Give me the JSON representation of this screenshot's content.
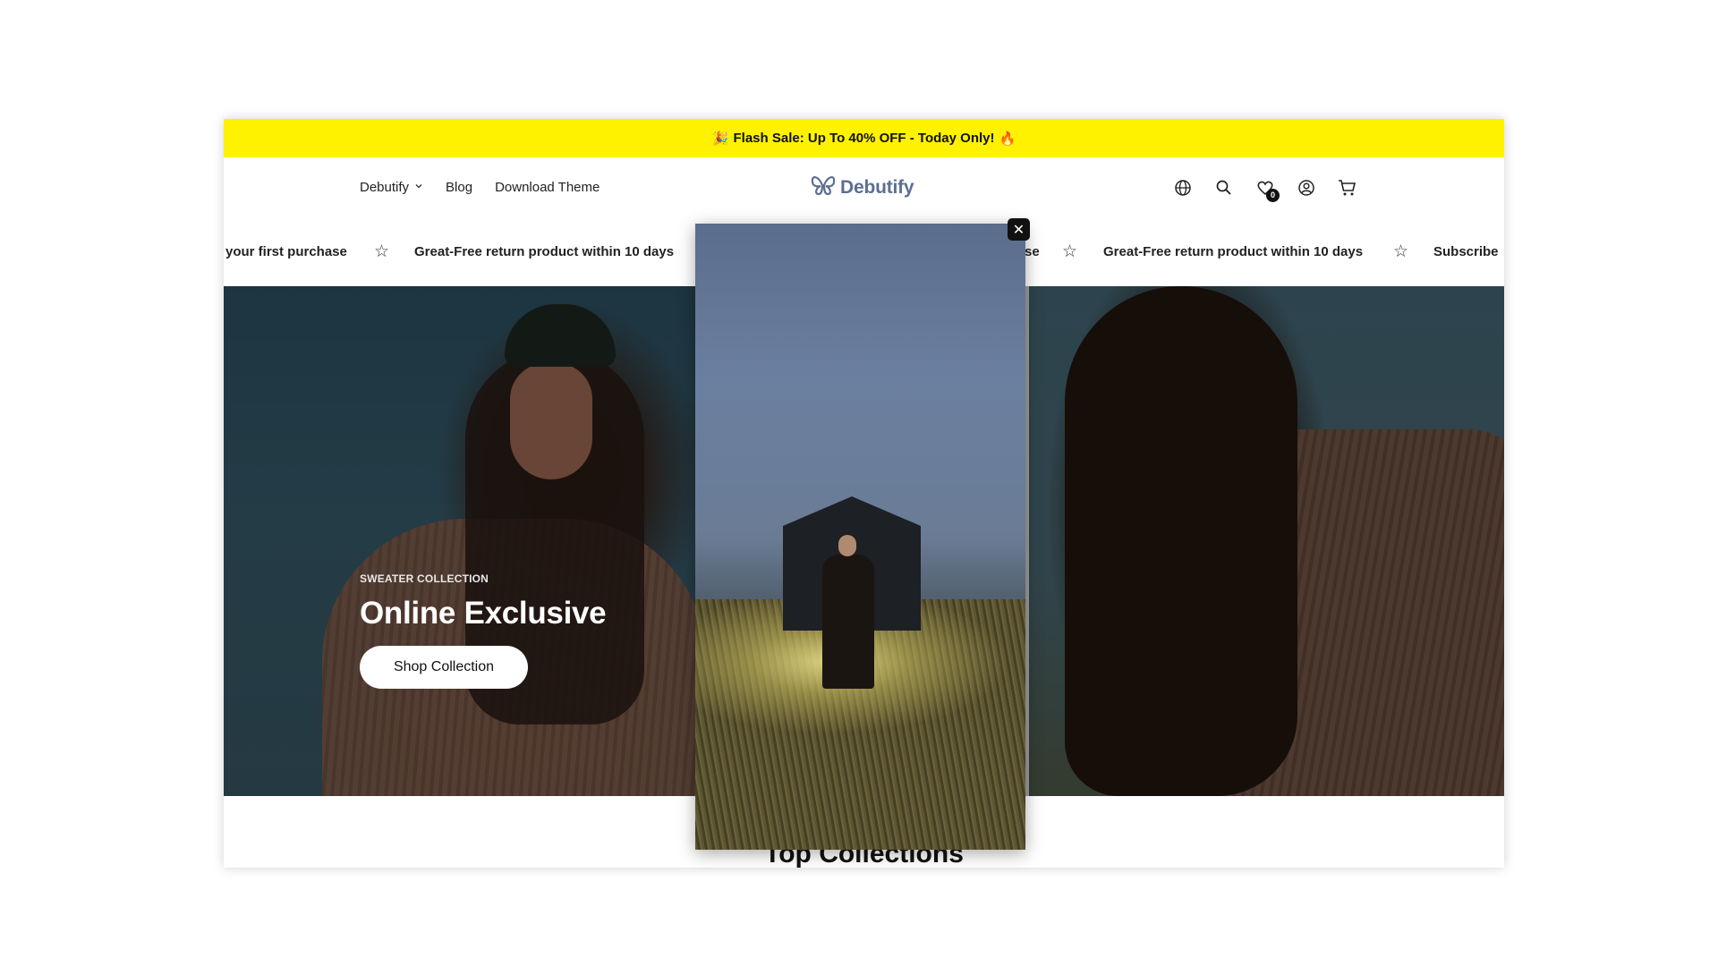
{
  "announcement": {
    "text": "Flash Sale: Up To 40% OFF - Today Only!",
    "icon_left": "🎉",
    "icon_right": "🔥",
    "background": "#FFF200"
  },
  "nav": {
    "items": [
      {
        "label": "Debutify",
        "has_dropdown": true
      },
      {
        "label": "Blog"
      },
      {
        "label": "Download Theme"
      }
    ]
  },
  "logo": {
    "text": "Debutify",
    "color": "#5c6f93"
  },
  "header_icons": {
    "globe": "globe-icon",
    "search": "search-icon",
    "wishlist": "heart-icon",
    "wishlist_count": "0",
    "account": "user-circle-icon",
    "cart": "cart-icon"
  },
  "marquee": {
    "t1": "your first purchase",
    "t2": "Great-Free return product within 10 days",
    "t3": "se",
    "t4": "Great-Free return product within 10 days",
    "t5": "Subscribe",
    "star": "☆"
  },
  "hero": {
    "eyebrow": "SWEATER COLLECTION",
    "headline": "Online Exclusive",
    "cta": "Shop Collection"
  },
  "section": {
    "title": "Top Collections"
  },
  "modal": {
    "close": "✕"
  }
}
